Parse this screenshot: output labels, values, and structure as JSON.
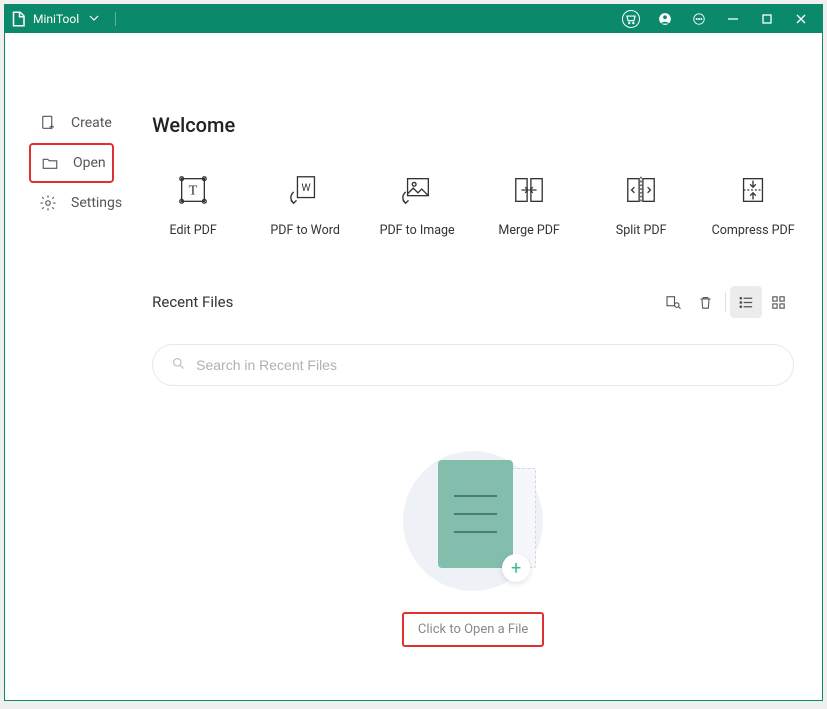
{
  "titlebar": {
    "app_name": "MiniTool"
  },
  "sidebar": {
    "items": [
      {
        "label": "Create"
      },
      {
        "label": "Open"
      },
      {
        "label": "Settings"
      }
    ]
  },
  "main": {
    "welcome": "Welcome",
    "tools": [
      {
        "label": "Edit PDF"
      },
      {
        "label": "PDF to Word"
      },
      {
        "label": "PDF to Image"
      },
      {
        "label": "Merge PDF"
      },
      {
        "label": "Split PDF"
      },
      {
        "label": "Compress PDF"
      }
    ],
    "recent": {
      "title": "Recent Files",
      "search_placeholder": "Search in Recent Files"
    },
    "open_button": "Click to Open a File"
  }
}
